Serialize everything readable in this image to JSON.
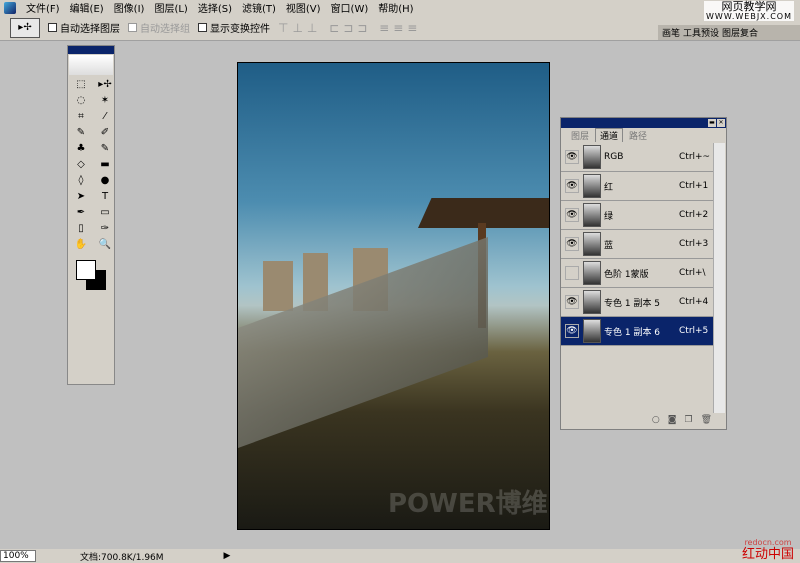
{
  "menu": [
    "文件(F)",
    "编辑(E)",
    "图像(I)",
    "图层(L)",
    "选择(S)",
    "滤镜(T)",
    "视图(V)",
    "窗口(W)",
    "帮助(H)"
  ],
  "options": {
    "auto_select_layer": "自动选择图层",
    "auto_select_group": "自动选择组",
    "show_transform": "显示变换控件",
    "align_icons": "⊤⊥⊥ ⊏⊐⊐ ≡≡≡"
  },
  "wells": [
    "画笔",
    "工具预设",
    "图层复合"
  ],
  "watermark_top": {
    "line1": "网页教学网",
    "line2": "WWW.WEBJX.COM"
  },
  "toolbox": {
    "tools": [
      "⬚",
      "▸✢",
      "◌",
      "✶",
      "⌗",
      "⁄",
      "✎",
      "✐",
      "♣",
      "✎",
      "◇",
      "▬",
      "◊",
      "●",
      "➤",
      "T",
      "✒",
      "▭",
      "▯",
      "✑",
      "✋",
      "🔍"
    ]
  },
  "canvas": {
    "watermark": "POWER博维"
  },
  "channels": {
    "tabs": [
      "图层",
      "通道",
      "路径"
    ],
    "rows": [
      {
        "name": "RGB",
        "shortcut": "Ctrl+~",
        "visible": true
      },
      {
        "name": "红",
        "shortcut": "Ctrl+1",
        "visible": true
      },
      {
        "name": "绿",
        "shortcut": "Ctrl+2",
        "visible": true
      },
      {
        "name": "蓝",
        "shortcut": "Ctrl+3",
        "visible": true
      },
      {
        "name": "色阶 1蒙版",
        "shortcut": "Ctrl+\\",
        "visible": false
      },
      {
        "name": "专色 1 副本 5",
        "shortcut": "Ctrl+4",
        "visible": true
      },
      {
        "name": "专色 1 副本 6",
        "shortcut": "Ctrl+5",
        "visible": true,
        "selected": true
      }
    ],
    "footer_icons": [
      "○",
      "◙",
      "❐",
      "🗑"
    ]
  },
  "status": {
    "zoom": "100%",
    "doc": "文档:700.8K/1.96M"
  },
  "corner_watermark": {
    "line1": "redocn.com",
    "line2": "红动中国"
  }
}
